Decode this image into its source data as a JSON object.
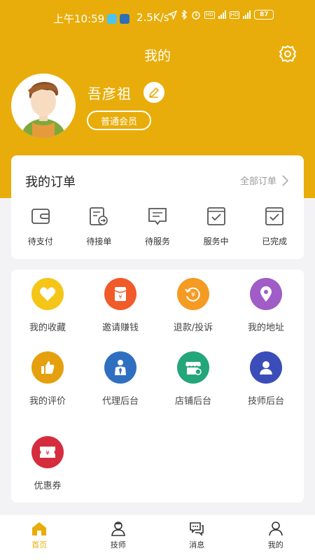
{
  "status_bar": {
    "time": "上午10:59",
    "network_speed": "2.5K/s",
    "net_label_1": "4G",
    "net_label_2": "5G",
    "hd_label": "HD",
    "battery": "87"
  },
  "header": {
    "title": "我的",
    "settings_icon": "gear-icon"
  },
  "profile": {
    "username": "吾彦祖",
    "member_level": "普通会员",
    "edit_icon": "pencil-icon"
  },
  "orders": {
    "title": "我的订单",
    "all_orders_label": "全部订单",
    "items": [
      {
        "label": "待支付",
        "icon": "wallet-icon"
      },
      {
        "label": "待接单",
        "icon": "receive-order-icon"
      },
      {
        "label": "待服务",
        "icon": "message-list-icon"
      },
      {
        "label": "服务中",
        "icon": "check-box-icon"
      },
      {
        "label": "已完成",
        "icon": "check-box-icon"
      }
    ]
  },
  "services": {
    "items": [
      {
        "label": "我的收藏",
        "icon": "heart-icon",
        "color": "#f5c518"
      },
      {
        "label": "邀请赚钱",
        "icon": "red-envelope-icon",
        "color": "#f15a29"
      },
      {
        "label": "退款/投诉",
        "icon": "refund-icon",
        "color": "#f59a23"
      },
      {
        "label": "我的地址",
        "icon": "location-pin-icon",
        "color": "#a05cc7"
      },
      {
        "label": "我的评价",
        "icon": "thumbs-up-icon",
        "color": "#e5a00d"
      },
      {
        "label": "代理后台",
        "icon": "agent-icon",
        "color": "#2f6fc0"
      },
      {
        "label": "店铺后台",
        "icon": "shop-icon",
        "color": "#23a67a"
      },
      {
        "label": "技师后台",
        "icon": "technician-icon",
        "color": "#3b4db8"
      },
      {
        "label": "优惠券",
        "icon": "coupon-icon",
        "color": "#d62d3e"
      }
    ]
  },
  "bottom_nav": {
    "items": [
      {
        "label": "首页",
        "icon": "home-icon",
        "active": true
      },
      {
        "label": "技师",
        "icon": "technician-nav-icon",
        "active": false
      },
      {
        "label": "消息",
        "icon": "chat-icon",
        "active": false
      },
      {
        "label": "我的",
        "icon": "person-icon",
        "active": false
      }
    ]
  },
  "colors": {
    "brand": "#e8ad0a",
    "background": "#f3f3f5",
    "card": "#ffffff"
  }
}
